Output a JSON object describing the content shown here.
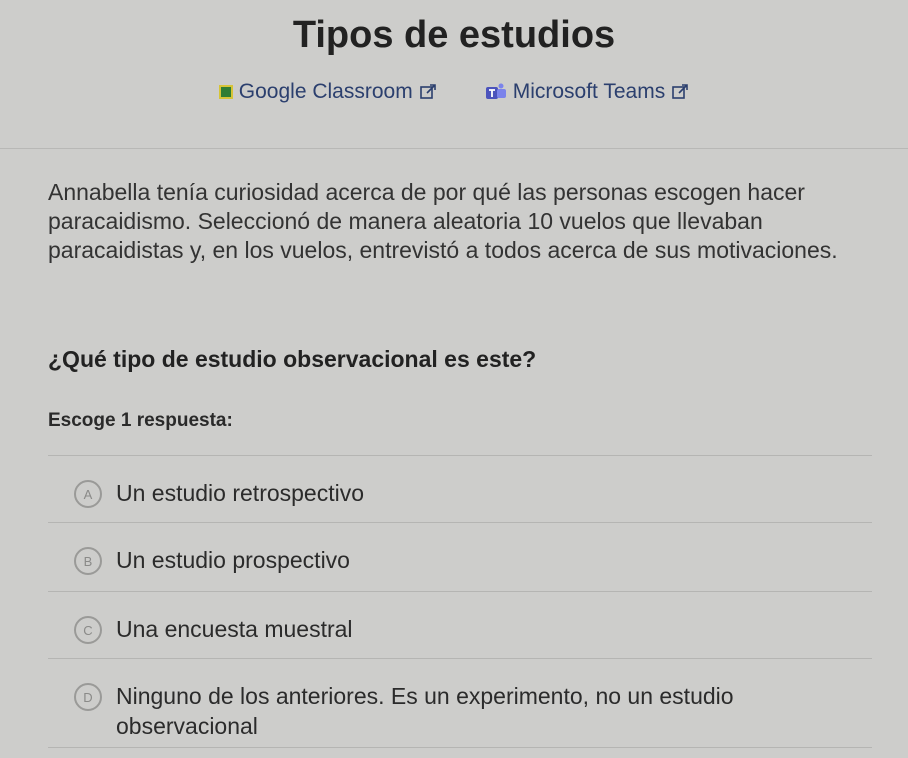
{
  "title": "Tipos de estudios",
  "share": {
    "google_classroom": "Google Classroom",
    "microsoft_teams": "Microsoft Teams"
  },
  "passage": "Annabella tenía curiosidad acerca de por qué las personas escogen hacer paracaidismo. Seleccionó de manera aleatoria 10 vuelos que llevaban paracaidistas y, en los vuelos, entrevistó a todos acerca de sus motivaciones.",
  "question": "¿Qué tipo de estudio observacional es este?",
  "instruction": "Escoge 1 respuesta:",
  "choices": [
    {
      "letter": "A",
      "text": "Un estudio retrospectivo"
    },
    {
      "letter": "B",
      "text": "Un estudio prospectivo"
    },
    {
      "letter": "C",
      "text": "Una encuesta muestral"
    },
    {
      "letter": "D",
      "text": "Ninguno de los anteriores. Es un experimento, no un estudio observacional"
    }
  ],
  "colors": {
    "background": "#cdcdcb",
    "link": "#2b3f6e",
    "google_icon": "#2f7d33",
    "teams_icon": "#4b53bc"
  },
  "icons": [
    "google-classroom-icon",
    "external-link-icon",
    "microsoft-teams-icon"
  ]
}
